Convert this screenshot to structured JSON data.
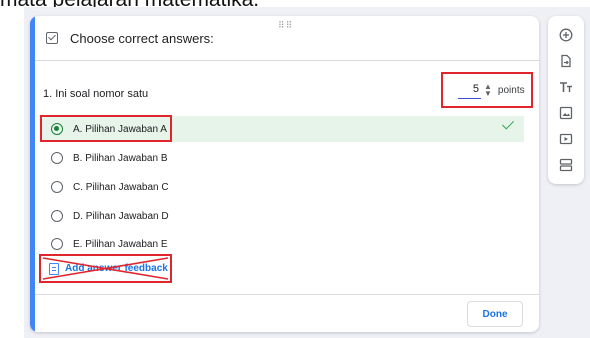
{
  "background_text": "mata pelajaran matematika.",
  "header": {
    "title": "Choose correct answers:"
  },
  "question": {
    "title": "1. Ini soal nomor satu",
    "points_value": "5",
    "points_label": "points"
  },
  "options": [
    {
      "label": "A. Pilihan Jawaban A",
      "correct": true
    },
    {
      "label": "B. Pilihan Jawaban B",
      "correct": false
    },
    {
      "label": "C. Pilihan Jawaban C",
      "correct": false
    },
    {
      "label": "D. Pilihan Jawaban D",
      "correct": false
    },
    {
      "label": "E. Pilihan Jawaban E",
      "correct": false
    }
  ],
  "feedback": {
    "label": "Add answer feedback"
  },
  "footer": {
    "done_label": "Done"
  },
  "toolbar": {
    "items": [
      "add-question-icon",
      "import-questions-icon",
      "add-title-icon",
      "add-image-icon",
      "add-video-icon",
      "add-section-icon"
    ]
  },
  "colors": {
    "accent": "#4285f4",
    "correct": "#188038",
    "annotation": "#e0262c",
    "link": "#1a73e8"
  }
}
